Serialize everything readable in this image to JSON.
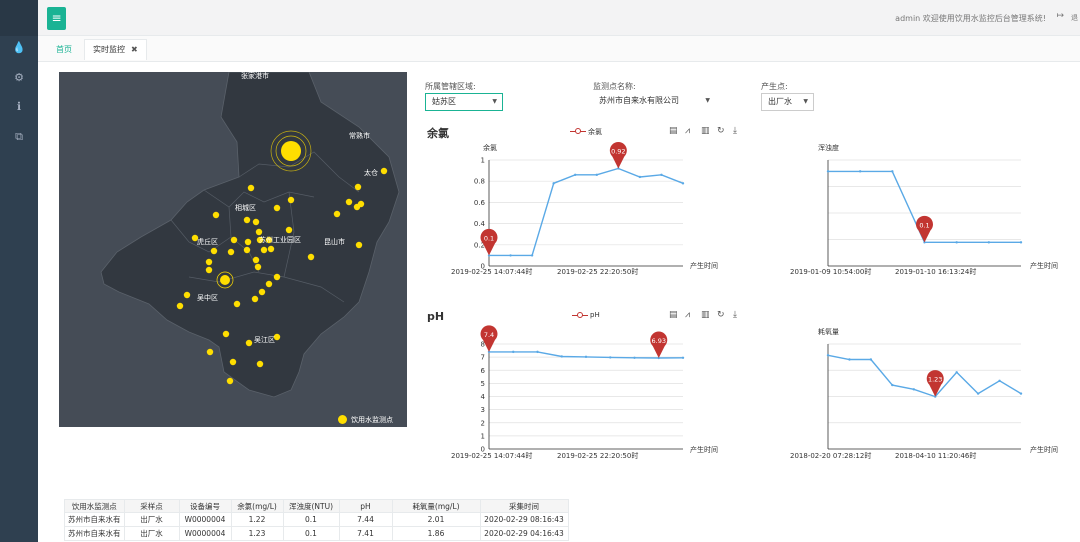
{
  "sidebar": {
    "icons": [
      "drop-icon",
      "gear-icon",
      "info-icon",
      "copy-icon"
    ],
    "glyphs": [
      "💧",
      "⚙",
      "ℹ",
      "⧉"
    ]
  },
  "topbar": {
    "menu_glyph": "≡",
    "welcome": "admin 欢迎使用饮用水监控后台管理系统!",
    "exit_glyph": "↦",
    "exit_label": "退"
  },
  "tabs": {
    "home": "首页",
    "active": "实时监控",
    "close_glyph": "✖"
  },
  "map": {
    "labels": [
      "张家港市",
      "常熟市",
      "太仓",
      "相城区",
      "虎丘区",
      "苏州工业园区",
      "昆山市",
      "吴中区",
      "吴江区"
    ],
    "legend": "饮用水监测点",
    "point_color": "#ffde00"
  },
  "filters": {
    "area_label": "所属管辖区域:",
    "area_value": "姑苏区",
    "station_label": "监测点名称:",
    "station_value": "苏州市自来水有限公司",
    "point_label": "产生点:",
    "point_value": "出厂水",
    "caret": "▼"
  },
  "chart_data": [
    {
      "type": "line",
      "title": "余氯",
      "legend": "余氯",
      "ylabel": "余氯",
      "xlabel": "产生时间",
      "ylim": [
        0,
        1
      ],
      "yticks": [
        "1",
        "0.8",
        "0.6",
        "0.4",
        "0.2",
        "0"
      ],
      "xticks": [
        "2019-02-25 14:07:44时",
        "2019-02-25 22:20:50时"
      ],
      "values": [
        0.1,
        0.1,
        0.1,
        0.78,
        0.86,
        0.86,
        0.92,
        0.84,
        0.86,
        0.78
      ],
      "markers": [
        "0.1",
        "0.92"
      ]
    },
    {
      "type": "line",
      "ylabel": "浑浊度",
      "xlabel": "产生时间",
      "xticks": [
        "2019-01-09 10:54:00时",
        "2019-01-10 16:13:24时"
      ],
      "values": [
        0.4,
        0.4,
        0.4,
        0.1,
        0.1,
        0.1,
        0.1
      ],
      "markers": [
        "0.1"
      ]
    },
    {
      "type": "line",
      "title": "pH",
      "legend": "pH",
      "xlabel": "产生时间",
      "ylim": [
        0,
        8
      ],
      "yticks": [
        "8",
        "7",
        "6",
        "5",
        "4",
        "3",
        "2",
        "1",
        "0"
      ],
      "xticks": [
        "2019-02-25 14:07:44时",
        "2019-02-25 22:20:50时"
      ],
      "values": [
        7.4,
        7.4,
        7.4,
        7.05,
        7.02,
        6.98,
        6.95,
        6.93,
        6.95
      ],
      "markers": [
        "7.4",
        "6.93"
      ]
    },
    {
      "type": "line",
      "ylabel": "耗氧量",
      "xlabel": "产生时间",
      "xticks": [
        "2018-02-20 07:28:12时",
        "2018-04-10 11:20:46时"
      ],
      "values": [
        2.2,
        2.1,
        2.1,
        1.5,
        1.4,
        1.23,
        1.8,
        1.3,
        1.6,
        1.3
      ],
      "markers": [
        "1.23"
      ]
    }
  ],
  "table": {
    "headers": [
      "饮用水监测点",
      "采样点",
      "设备编号",
      "余氯(mg/L)",
      "浑浊度(NTU)",
      "pH",
      "耗氧量(mg/L)",
      "采集时间"
    ],
    "rows": [
      [
        "苏州市自来水有",
        "出厂水",
        "W0000004",
        "1.22",
        "0.1",
        "7.44",
        "2.01",
        "2020-02-29 08:16:43"
      ],
      [
        "苏州市自来水有",
        "出厂水",
        "W0000004",
        "1.23",
        "0.1",
        "7.41",
        "1.86",
        "2020-02-29 04:16:43"
      ]
    ]
  }
}
